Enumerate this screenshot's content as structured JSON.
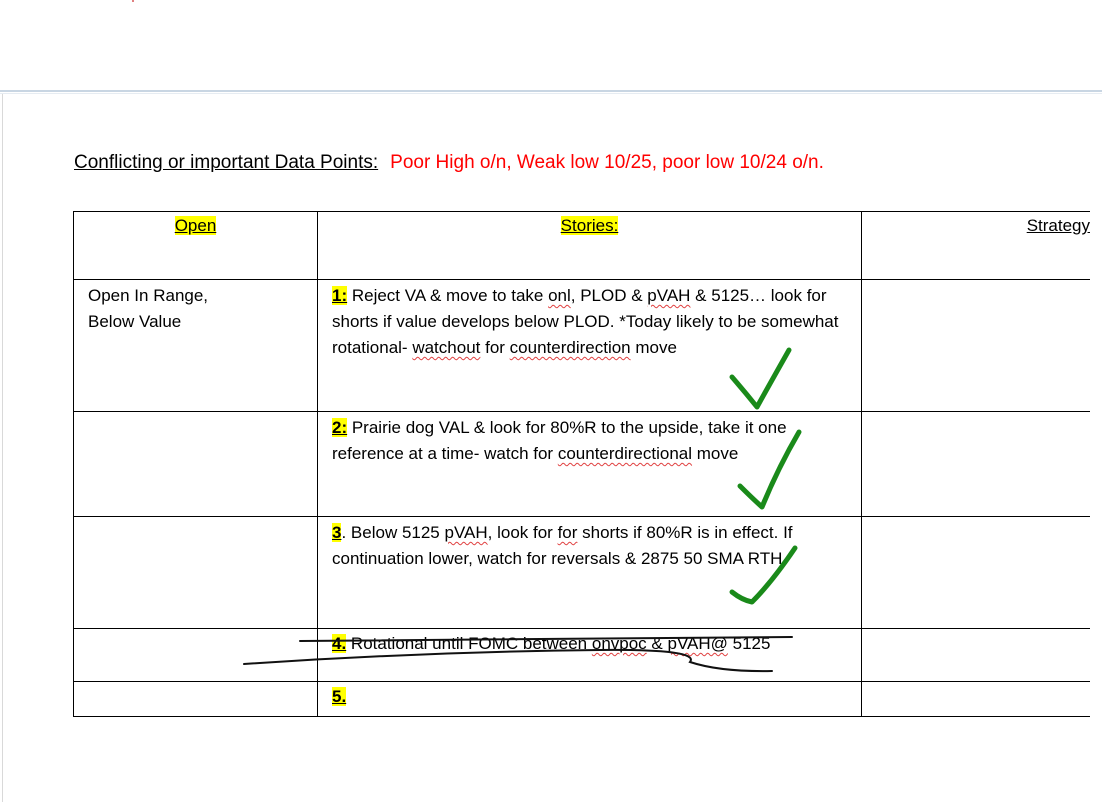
{
  "document": {
    "conflict_label": "Conflicting or important Data Points:",
    "conflict_value": "Poor High o/n, Weak low 10/25, poor low 10/24 o/n."
  },
  "table": {
    "headers": {
      "open": "Open",
      "stories": "Stories:",
      "strategy": "Strategy"
    },
    "rows": [
      {
        "open_line1": "Open In Range,",
        "open_line2": "Below Value",
        "num": "1:",
        "t1": " Reject VA & move to take ",
        "w1": "onl",
        "t2": ", PLOD & ",
        "w2": "pVAH",
        "t3": " & 5125… look for shorts if value develops below PLOD. *Today likely to be somewhat rotational- ",
        "w3": "watchout",
        "t4": " for ",
        "w4": "counterdirection",
        "t5": " move"
      },
      {
        "num": "2:",
        "t1": " Prairie dog VAL & look for 80%R to the upside, take it one reference at a time- watch for ",
        "w1": "counterdirectional",
        "t2": " move"
      },
      {
        "num": "3",
        "t0": ".  Below 5125 ",
        "w1": "pVAH",
        "t1": ", look for ",
        "w2": "for",
        "t2": " shorts if 80%R is in effect.  If continuation lower, watch for reversals & 2875 50 SMA RTH"
      },
      {
        "num": "4.",
        "t1": " Rotational until FOMC between ",
        "w1": "onvpoc",
        "t2": " & ",
        "w2": "pVAH@",
        "t3": " 5125"
      },
      {
        "num": "5."
      }
    ]
  },
  "colors": {
    "accent_red": "#ff0000",
    "highlight": "#ffff00",
    "check_green": "#1a8a1a"
  }
}
